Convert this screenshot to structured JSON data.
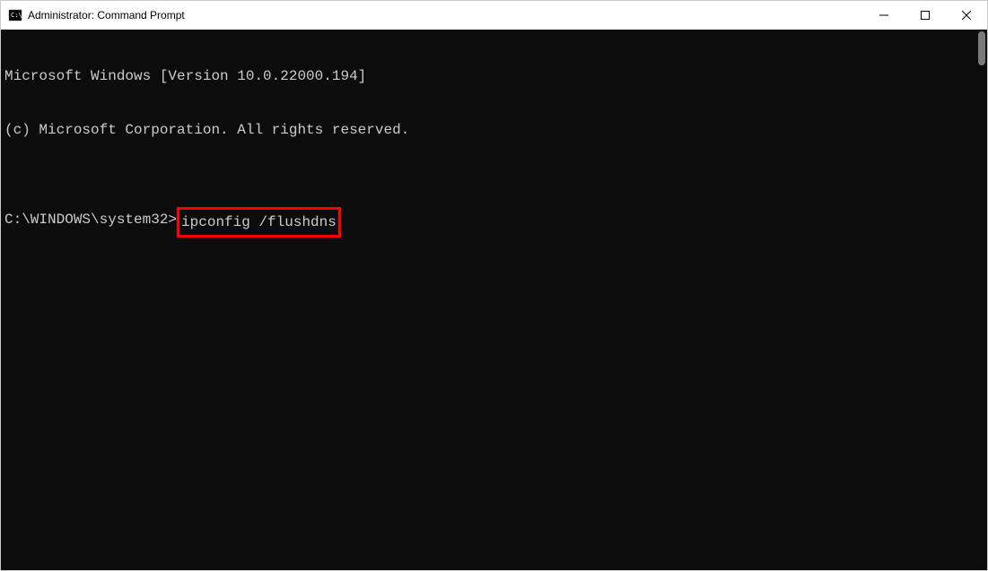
{
  "window": {
    "title": "Administrator: Command Prompt"
  },
  "terminal": {
    "line1": "Microsoft Windows [Version 10.0.22000.194]",
    "line2": "(c) Microsoft Corporation. All rights reserved.",
    "blank": "",
    "prompt": "C:\\WINDOWS\\system32>",
    "command": "ipconfig /flushdns"
  },
  "highlight": {
    "color": "#ff0000"
  }
}
